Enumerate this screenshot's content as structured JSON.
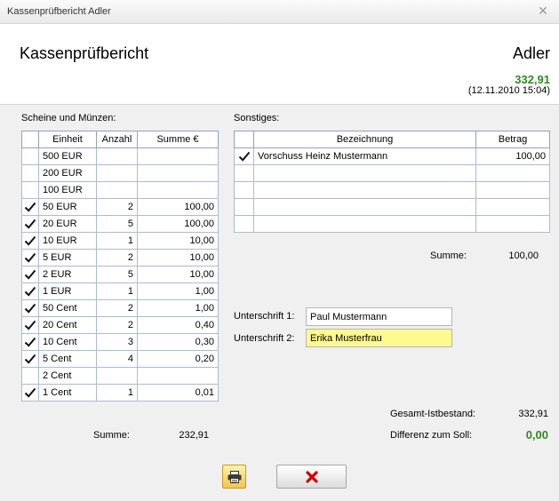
{
  "window": {
    "title": "Kassenprüfbericht Adler"
  },
  "header": {
    "heading": "Kassenprüfbericht",
    "register_name": "Adler",
    "total": "332,91",
    "timestamp": "(12.11.2010 15:04)"
  },
  "cash": {
    "label": "Scheine und Münzen:",
    "columns": [
      "Einheit",
      "Anzahl",
      "Summe €"
    ],
    "rows": [
      {
        "checked": false,
        "unit": "500 EUR",
        "count": "",
        "sum": ""
      },
      {
        "checked": false,
        "unit": "200 EUR",
        "count": "",
        "sum": ""
      },
      {
        "checked": false,
        "unit": "100 EUR",
        "count": "",
        "sum": ""
      },
      {
        "checked": true,
        "unit": "50 EUR",
        "count": "2",
        "sum": "100,00"
      },
      {
        "checked": true,
        "unit": "20 EUR",
        "count": "5",
        "sum": "100,00"
      },
      {
        "checked": true,
        "unit": "10 EUR",
        "count": "1",
        "sum": "10,00"
      },
      {
        "checked": true,
        "unit": "5 EUR",
        "count": "2",
        "sum": "10,00"
      },
      {
        "checked": true,
        "unit": "2 EUR",
        "count": "5",
        "sum": "10,00"
      },
      {
        "checked": true,
        "unit": "1 EUR",
        "count": "1",
        "sum": "1,00"
      },
      {
        "checked": true,
        "unit": "50 Cent",
        "count": "2",
        "sum": "1,00"
      },
      {
        "checked": true,
        "unit": "20 Cent",
        "count": "2",
        "sum": "0,40"
      },
      {
        "checked": true,
        "unit": "10 Cent",
        "count": "3",
        "sum": "0,30"
      },
      {
        "checked": true,
        "unit": "5 Cent",
        "count": "4",
        "sum": "0,20"
      },
      {
        "checked": false,
        "unit": "2 Cent",
        "count": "",
        "sum": ""
      },
      {
        "checked": true,
        "unit": "1 Cent",
        "count": "1",
        "sum": "0,01"
      }
    ],
    "sum_label": "Summe:",
    "sum_value": "232,91"
  },
  "other": {
    "label": "Sonstiges:",
    "columns": [
      "Bezeichnung",
      "Betrag"
    ],
    "rows": [
      {
        "checked": true,
        "name": "Vorschuss Heinz Mustermann",
        "amount": "100,00"
      },
      {
        "checked": false,
        "name": "",
        "amount": ""
      },
      {
        "checked": false,
        "name": "",
        "amount": ""
      },
      {
        "checked": false,
        "name": "",
        "amount": ""
      },
      {
        "checked": false,
        "name": "",
        "amount": ""
      }
    ],
    "sum_label": "Summe:",
    "sum_value": "100,00"
  },
  "signatures": {
    "label1": "Unterschrift 1:",
    "value1": "Paul Mustermann",
    "label2": "Unterschrift 2:",
    "value2": "Erika Musterfrau"
  },
  "totals": {
    "actual_label": "Gesamt-Istbestand:",
    "actual_value": "332,91",
    "diff_label": "Differenz zum Soll:",
    "diff_value": "0,00"
  },
  "colors": {
    "positive": "#2e8b22",
    "highlight_field": "#fdfa90"
  },
  "icons": {
    "print": "printer-icon",
    "cancel": "red-x-icon",
    "close": "close-icon",
    "check": "checkmark-icon"
  }
}
